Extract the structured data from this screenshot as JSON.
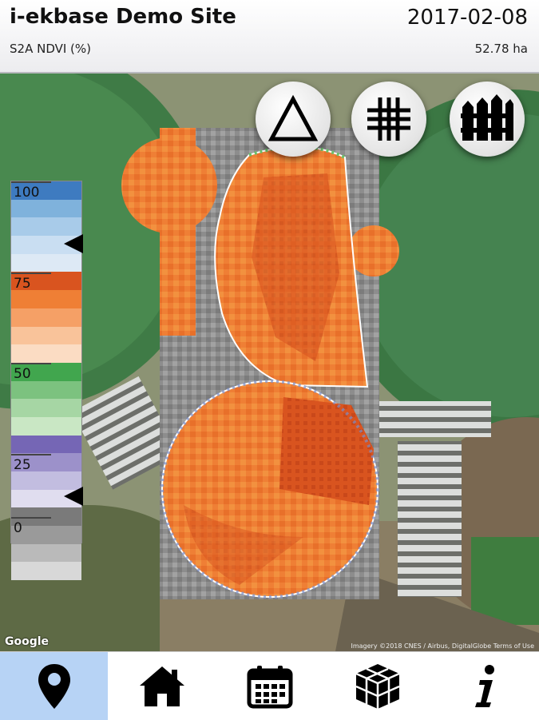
{
  "header": {
    "title": "i-ekbase Demo Site",
    "date": "2017-02-08",
    "layer": "S2A NDVI (%)",
    "area": "52.78 ha"
  },
  "map": {
    "buttons": [
      {
        "name": "triangle-icon"
      },
      {
        "name": "grid-icon"
      },
      {
        "name": "fence-icon"
      }
    ],
    "legend": {
      "ticks": [
        "100",
        "75",
        "50",
        "25",
        "0"
      ],
      "colors": [
        "#3e7bc0",
        "#7fb2dc",
        "#a8cbe9",
        "#c9def2",
        "#dde9f5",
        "#d9541f",
        "#ef7f35",
        "#f5a066",
        "#f9c39a",
        "#fbdcc3",
        "#41a64e",
        "#7cc27f",
        "#a6d6a4",
        "#c9e7c4",
        "#7566b5",
        "#9c91ca",
        "#c2bde0",
        "#e0ddef",
        "#7a7a7a",
        "#9a9a9a",
        "#bababa",
        "#d8d8d8"
      ]
    },
    "google_label": "Google",
    "attribution": "Imagery ©2018 CNES / Airbus, DigitalGlobe   Terms of Use"
  },
  "nav": {
    "items": [
      {
        "name": "location-pin-icon",
        "active": true
      },
      {
        "name": "home-icon",
        "active": false
      },
      {
        "name": "calendar-icon",
        "active": false
      },
      {
        "name": "layers-box-icon",
        "active": false
      },
      {
        "name": "info-icon",
        "active": false
      }
    ]
  },
  "colors": {
    "active_nav": "#b7d3f5",
    "ndvi_orange": "#ef7f35",
    "ndvi_dark": "#d9541f"
  }
}
